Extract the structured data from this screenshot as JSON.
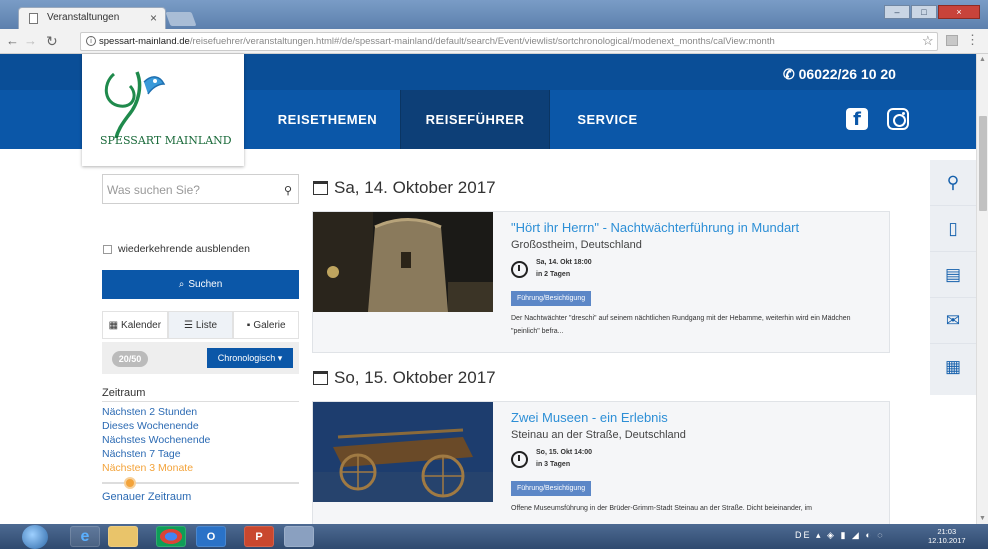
{
  "browser": {
    "tab_title": "Veranstaltungen",
    "url_host": "spessart-mainland.de",
    "url_path": "/reisefuehrer/veranstaltungen.html#/de/spessart-mainland/default/search/Event/viewlist/sortchronological/modenext_months/calView:month"
  },
  "header": {
    "phone": "06022/26 10 20",
    "logo_text": "SPESSART MAINLAND",
    "nav": [
      {
        "label": "REISETHEMEN",
        "active": false
      },
      {
        "label": "REISEFÜHRER",
        "active": true
      },
      {
        "label": "SERVICE",
        "active": false
      }
    ]
  },
  "sidebar": {
    "search_placeholder": "Was suchen Sie?",
    "hide_recurring_label": "wiederkehrende ausblenden",
    "search_button": "Suchen",
    "views": [
      "Kalender",
      "Liste",
      "Galerie"
    ],
    "result_count": "20/50",
    "sort_label": "Chronologisch",
    "zeitraum_heading": "Zeitraum",
    "zeitraum_options": [
      "Nächsten 2 Stunden",
      "Dieses Wochenende",
      "Nächstes Wochenende",
      "Nächsten 7 Tage",
      "Nächsten 3 Monate"
    ],
    "selected_zeitraum": "Nächsten 3 Monate",
    "genauer_label": "Genauer Zeitraum"
  },
  "events": [
    {
      "date_heading": "Sa, 14. Oktober 2017",
      "title": "\"Hört ihr Herrn\" - Nachtwächterführung in Mundart",
      "location": "Großostheim, Deutschland",
      "time_line1": "Sa, 14. Okt 18:00",
      "time_line2": "in 2 Tagen",
      "tag": "Führung/Besichtigung",
      "description": "Der Nachtwächter \"dreschi\" auf seinem nächtlichen Rundgang mit der Hebamme, weiterhin wird ein Mädchen \"peinlich\" befra..."
    },
    {
      "date_heading": "So, 15. Oktober 2017",
      "title": "Zwei Museen - ein Erlebnis",
      "location": "Steinau an der Straße, Deutschland",
      "time_line1": "So, 15. Okt 14:00",
      "time_line2": "in 3 Tagen",
      "tag": "Führung/Besichtigung",
      "description": "Offene Museumsführung in der Brüder-Grimm-Stadt Steinau an der Straße. Dicht beieinander, im"
    }
  ],
  "taskbar": {
    "lang": "DE",
    "time": "21:03",
    "date": "12.10.2017"
  },
  "colors": {
    "primary": "#0b57a8",
    "accent": "#f3a33a",
    "link": "#2b6ab3"
  }
}
